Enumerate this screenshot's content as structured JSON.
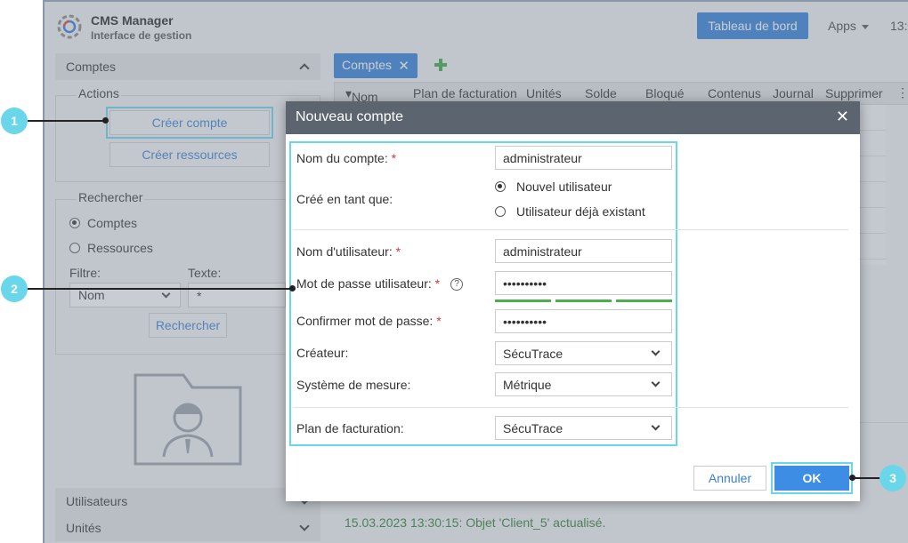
{
  "app": {
    "title": "CMS Manager",
    "subtitle": "Interface de gestion",
    "dashboard_button": "Tableau de bord",
    "apps_menu": "Apps",
    "clock": "13:"
  },
  "sidebar": {
    "section_title": "Comptes",
    "actions_legend": "Actions",
    "create_account": "Créer compte",
    "create_resources": "Créer ressources",
    "search_legend": "Rechercher",
    "radio_accounts": "Comptes",
    "radio_resources": "Ressources",
    "filter_label": "Filtre:",
    "text_label": "Texte:",
    "filter_value": "Nom",
    "text_value": "*",
    "search_button": "Rechercher",
    "users_section": "Utilisateurs",
    "units_section": "Unités"
  },
  "main": {
    "tab_label": "Comptes",
    "columns": [
      "Nom",
      "Plan de facturation",
      "Unités",
      "Solde",
      "Bloqué",
      "Contenus",
      "Journal",
      "Supprimer"
    ],
    "status_message": "15.03.2023 13:30:15: Objet 'Client_5' actualisé."
  },
  "modal": {
    "title": "Nouveau compte",
    "account_name_label": "Nom du compte:",
    "account_name_value": "administrateur",
    "created_as_label": "Créé en tant que:",
    "option_new_user": "Nouvel utilisateur",
    "option_existing_user": "Utilisateur déjà existant",
    "username_label": "Nom d'utilisateur:",
    "username_value": "administrateur",
    "password_label": "Mot de passe utilisateur:",
    "password_value": "••••••••••",
    "help_glyph": "?",
    "confirm_label": "Confirmer mot de passe:",
    "confirm_value": "••••••••••",
    "creator_label": "Créateur:",
    "creator_value": "SécuTrace",
    "measure_label": "Système de mesure:",
    "measure_value": "Métrique",
    "billing_label": "Plan de facturation:",
    "billing_value": "SécuTrace",
    "required_mark": "*",
    "close_glyph": "✕",
    "cancel_button": "Annuler",
    "ok_button": "OK"
  },
  "callouts": [
    "1",
    "2",
    "3"
  ],
  "colors": {
    "accent": "#2f7fd8",
    "callout": "#6ad6ea",
    "modal_header": "#5b646f",
    "strength": "#4cae4c",
    "status_text": "#2e7a2e"
  }
}
